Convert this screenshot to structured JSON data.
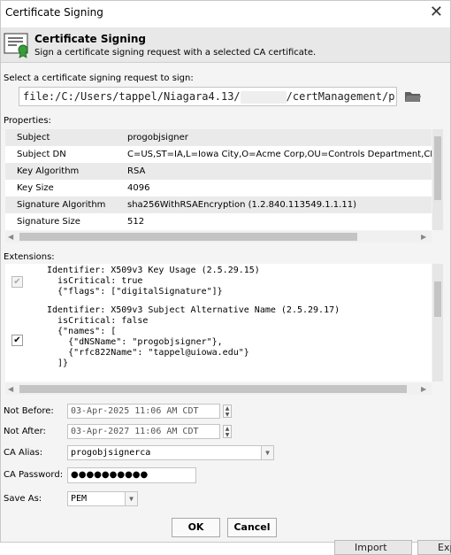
{
  "window": {
    "title": "Certificate Signing",
    "close_glyph": "✕"
  },
  "banner": {
    "title": "Certificate Signing",
    "subtitle": "Sign a certificate signing request with a selected CA certificate.",
    "icon": "certificate-icon"
  },
  "request": {
    "label": "Select a certificate signing request to sign:",
    "path_start": "file:/C:/Users/tappel/Niagara4.13/",
    "path_end": "/certManagement/proc",
    "browse_icon": "folder-icon"
  },
  "properties": {
    "label": "Properties:",
    "rows": [
      {
        "key": "Subject",
        "value": "progobjsigner"
      },
      {
        "key": "Subject DN",
        "value": "C=US,ST=IA,L=Iowa City,O=Acme Corp,OU=Controls Department,CN=progobjsigner"
      },
      {
        "key": "Key Algorithm",
        "value": "RSA"
      },
      {
        "key": "Key Size",
        "value": "4096"
      },
      {
        "key": "Signature Algorithm",
        "value": "sha256WithRSAEncryption (1.2.840.113549.1.1.11)"
      },
      {
        "key": "Signature Size",
        "value": "512"
      }
    ]
  },
  "extensions": {
    "label": "Extensions:",
    "ext1": {
      "lines": [
        "Identifier: X509v3 Key Usage (2.5.29.15)",
        "  isCritical: true",
        "  {\"flags\": [\"digitalSignature\"]}"
      ],
      "checked": true,
      "enabled": false
    },
    "ext2": {
      "lines": [
        "Identifier: X509v3 Subject Alternative Name (2.5.29.17)",
        "  isCritical: false",
        "  {\"names\": [",
        "    {\"dNSName\": \"progobjsigner\"},",
        "    {\"rfc822Name\": \"tappel@uiowa.edu\"}",
        "  ]}"
      ],
      "checked": true,
      "enabled": true
    }
  },
  "form": {
    "not_before_label": "Not Before:",
    "not_before_value": "03-Apr-2025 11:06 AM CDT",
    "not_after_label": "Not After:",
    "not_after_value": "03-Apr-2027 11:06 AM CDT",
    "ca_alias_label": "CA Alias:",
    "ca_alias_value": "progobjsignerca",
    "ca_password_label": "CA Password:",
    "ca_password_value": "●●●●●●●●●●",
    "save_as_label": "Save As:",
    "save_as_value": "PEM"
  },
  "buttons": {
    "ok": "OK",
    "cancel": "Cancel"
  },
  "background": {
    "import_label": "Import",
    "export_label": "Exp"
  }
}
